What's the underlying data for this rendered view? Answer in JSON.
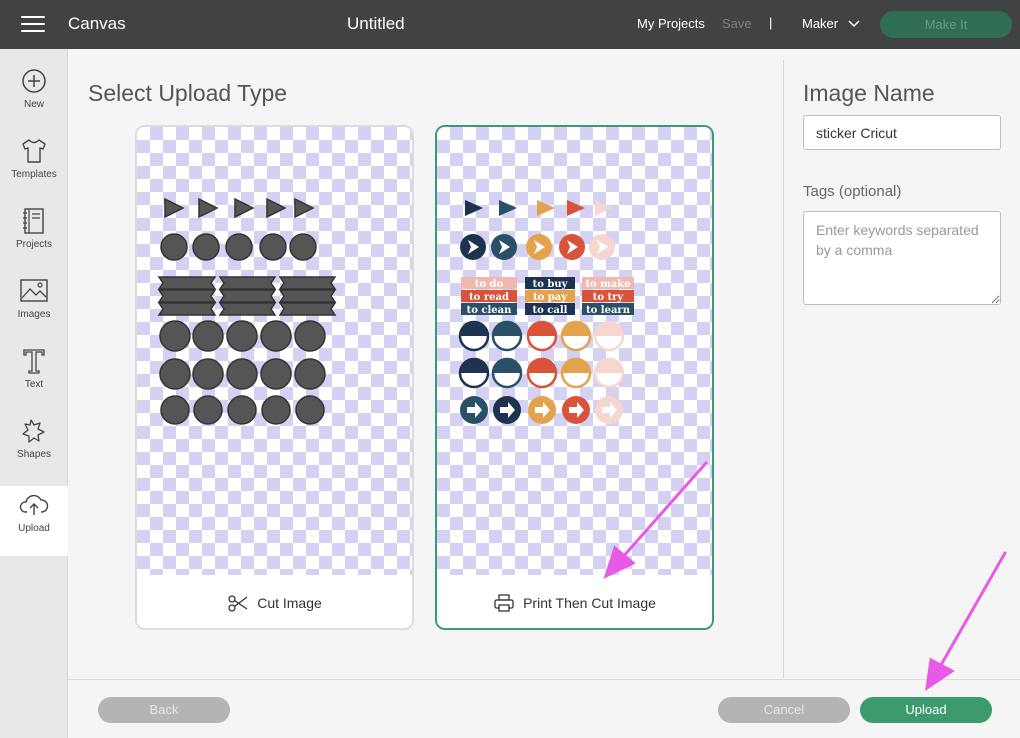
{
  "topbar": {
    "app_title": "Canvas",
    "doc_title": "Untitled",
    "my_projects": "My Projects",
    "save": "Save",
    "separator": "|",
    "machine": "Maker",
    "make_it": "Make It"
  },
  "sidebar": {
    "items": [
      {
        "label": "New",
        "icon": "plus-circle-icon"
      },
      {
        "label": "Templates",
        "icon": "tshirt-icon"
      },
      {
        "label": "Projects",
        "icon": "notebook-icon"
      },
      {
        "label": "Images",
        "icon": "image-icon"
      },
      {
        "label": "Text",
        "icon": "text-t-icon"
      },
      {
        "label": "Shapes",
        "icon": "shapes-icon"
      },
      {
        "label": "Upload",
        "icon": "cloud-upload-icon",
        "active": true
      }
    ]
  },
  "main": {
    "title": "Select Upload Type",
    "options": [
      {
        "label": "Cut Image",
        "icon": "scissors-icon",
        "selected": false
      },
      {
        "label": "Print Then Cut Image",
        "icon": "printer-icon",
        "selected": true
      }
    ],
    "print_preview_labels": [
      "to do",
      "to buy",
      "to make",
      "to read",
      "to pay",
      "to try",
      "to clean",
      "to call",
      "to learn"
    ]
  },
  "panel": {
    "title": "Image Name",
    "name_value": "sticker Cricut",
    "tags_label": "Tags (optional)",
    "tags_placeholder": "Enter keywords separated by a comma"
  },
  "footer": {
    "back": "Back",
    "cancel": "Cancel",
    "upload": "Upload"
  },
  "colors": {
    "topbar": "#414244",
    "accent_green": "#3c9a6e",
    "annotation_arrow": "#e85ae6",
    "checker": "#d4d1f2",
    "navy": "#1e3350",
    "orange": "#e3a24c",
    "red": "#d9533b",
    "pink": "#f2c7c0"
  }
}
